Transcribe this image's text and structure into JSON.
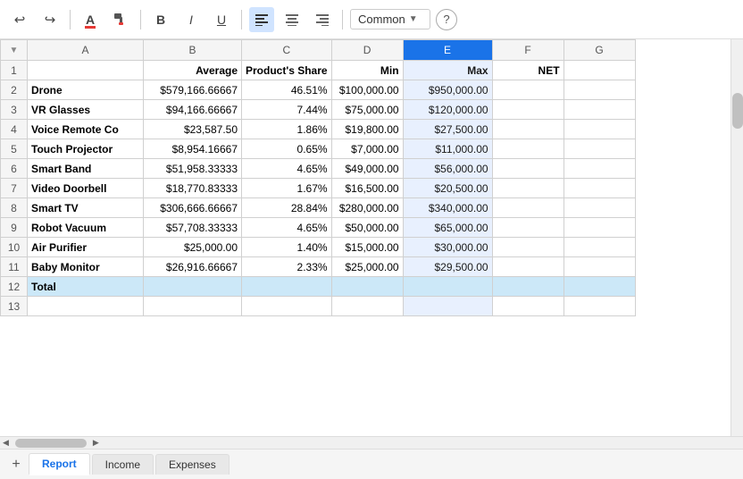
{
  "toolbar": {
    "undo_label": "↩",
    "redo_label": "↪",
    "font_color_label": "A",
    "paint_format_label": "🖌",
    "bold_label": "B",
    "italic_label": "I",
    "underline_label": "U",
    "align_left_label": "≡",
    "align_center_label": "≡",
    "align_right_label": "≡",
    "format_dropdown": "Common",
    "help_label": "?"
  },
  "columns": {
    "corner": "",
    "a": "A",
    "b": "B",
    "c": "C",
    "d": "D",
    "e": "E",
    "f": "F",
    "g": "G"
  },
  "header_row": {
    "a": "",
    "b": "Average",
    "c": "Product's Share",
    "d": "Min",
    "e": "Max",
    "f": "NET",
    "g": ""
  },
  "rows": [
    {
      "num": 2,
      "a": "Drone",
      "b": "$579,166.66667",
      "c": "46.51%",
      "d": "$100,000.00",
      "e": "$950,000.00",
      "f": "",
      "g": ""
    },
    {
      "num": 3,
      "a": "VR Glasses",
      "b": "$94,166.66667",
      "c": "7.44%",
      "d": "$75,000.00",
      "e": "$120,000.00",
      "f": "",
      "g": ""
    },
    {
      "num": 4,
      "a": "Voice Remote Co",
      "b": "$23,587.50",
      "c": "1.86%",
      "d": "$19,800.00",
      "e": "$27,500.00",
      "f": "",
      "g": ""
    },
    {
      "num": 5,
      "a": "Touch Projector",
      "b": "$8,954.16667",
      "c": "0.65%",
      "d": "$7,000.00",
      "e": "$11,000.00",
      "f": "",
      "g": ""
    },
    {
      "num": 6,
      "a": "Smart Band",
      "b": "$51,958.33333",
      "c": "4.65%",
      "d": "$49,000.00",
      "e": "$56,000.00",
      "f": "",
      "g": ""
    },
    {
      "num": 7,
      "a": "Video Doorbell",
      "b": "$18,770.83333",
      "c": "1.67%",
      "d": "$16,500.00",
      "e": "$20,500.00",
      "f": "",
      "g": ""
    },
    {
      "num": 8,
      "a": "Smart TV",
      "b": "$306,666.66667",
      "c": "28.84%",
      "d": "$280,000.00",
      "e": "$340,000.00",
      "f": "",
      "g": ""
    },
    {
      "num": 9,
      "a": "Robot Vacuum",
      "b": "$57,708.33333",
      "c": "4.65%",
      "d": "$50,000.00",
      "e": "$65,000.00",
      "f": "",
      "g": ""
    },
    {
      "num": 10,
      "a": "Air Purifier",
      "b": "$25,000.00",
      "c": "1.40%",
      "d": "$15,000.00",
      "e": "$30,000.00",
      "f": "",
      "g": ""
    },
    {
      "num": 11,
      "a": "Baby Monitor",
      "b": "$26,916.66667",
      "c": "2.33%",
      "d": "$25,000.00",
      "e": "$29,500.00",
      "f": "",
      "g": ""
    }
  ],
  "total_row": {
    "num": 12,
    "a": "Total",
    "b": "",
    "c": "",
    "d": "",
    "e": "",
    "f": "",
    "g": ""
  },
  "empty_rows": [
    13
  ],
  "tabs": [
    {
      "label": "Report",
      "active": true
    },
    {
      "label": "Income",
      "active": false
    },
    {
      "label": "Expenses",
      "active": false
    }
  ],
  "add_sheet_label": "+"
}
